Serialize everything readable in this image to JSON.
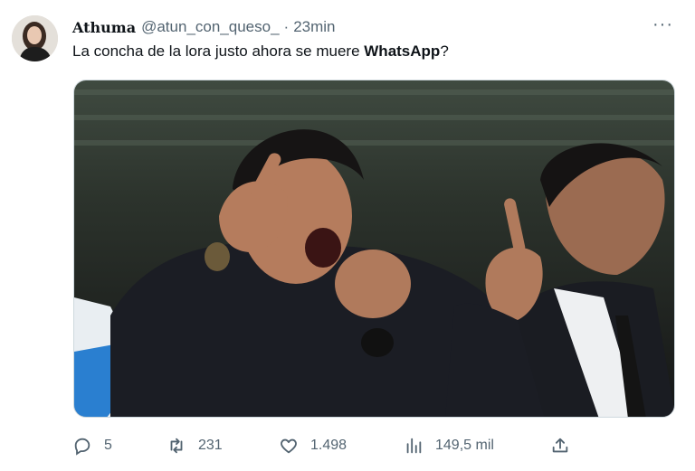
{
  "tweet": {
    "display_name": "Athuma",
    "handle": "@atun_con_queso_",
    "separator": "·",
    "time": "23min",
    "more": "···",
    "text_before": "La concha de la lora justo ahora se muere ",
    "text_bold": "WhatsApp",
    "text_after": "?"
  },
  "actions": {
    "replies": "5",
    "retweets": "231",
    "likes": "1.498",
    "views": "149,5 mil"
  },
  "icons": [
    "reply-icon",
    "retweet-icon",
    "like-icon",
    "views-icon",
    "share-icon"
  ],
  "colors": {
    "text": "#0f1419",
    "muted": "#536471",
    "border": "#cfd9de"
  }
}
